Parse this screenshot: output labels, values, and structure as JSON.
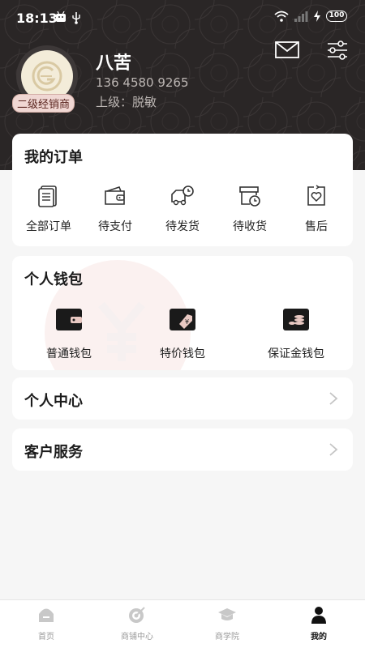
{
  "status_bar": {
    "time": "18:13",
    "battery": "100",
    "icons": [
      "android-icon",
      "usb-icon",
      "wifi-icon",
      "signal-icon",
      "charging-icon"
    ]
  },
  "header": {
    "icons": [
      "mail-icon",
      "settings-sliders-icon"
    ],
    "user": {
      "name": "八苦",
      "phone": "136 4580 9265",
      "superior": "上级：脱敏",
      "level": "二级经销商",
      "avatar_icon": "brand-logo-icon"
    }
  },
  "orders": {
    "title": "我的订单",
    "items": [
      {
        "label": "全部订单",
        "icon": "document-list-icon"
      },
      {
        "label": "待支付",
        "icon": "wallet-icon"
      },
      {
        "label": "待发货",
        "icon": "delivery-truck-icon"
      },
      {
        "label": "待收货",
        "icon": "package-clock-icon"
      },
      {
        "label": "售后",
        "icon": "heart-return-icon"
      }
    ]
  },
  "wallet": {
    "title": "个人钱包",
    "items": [
      {
        "label": "普通钱包",
        "icon": "wallet-icon"
      },
      {
        "label": "特价钱包",
        "icon": "price-tag-wallet-icon"
      },
      {
        "label": "保证金钱包",
        "icon": "coins-wallet-icon"
      }
    ]
  },
  "personal_center": {
    "title": "个人中心"
  },
  "customer_service": {
    "title": "客户服务"
  },
  "tabbar": {
    "items": [
      {
        "label": "首页",
        "icon": "home-icon",
        "active": false
      },
      {
        "label": "商铺中心",
        "icon": "target-icon",
        "active": false
      },
      {
        "label": "商学院",
        "icon": "graduation-cap-icon",
        "active": false
      },
      {
        "label": "我的",
        "icon": "user-icon",
        "active": true
      }
    ]
  },
  "colors": {
    "header_bg": "#2a2626",
    "page_bg": "#f6f6f6",
    "badge_bg": "#f0d7d3",
    "accent": "#111111"
  }
}
